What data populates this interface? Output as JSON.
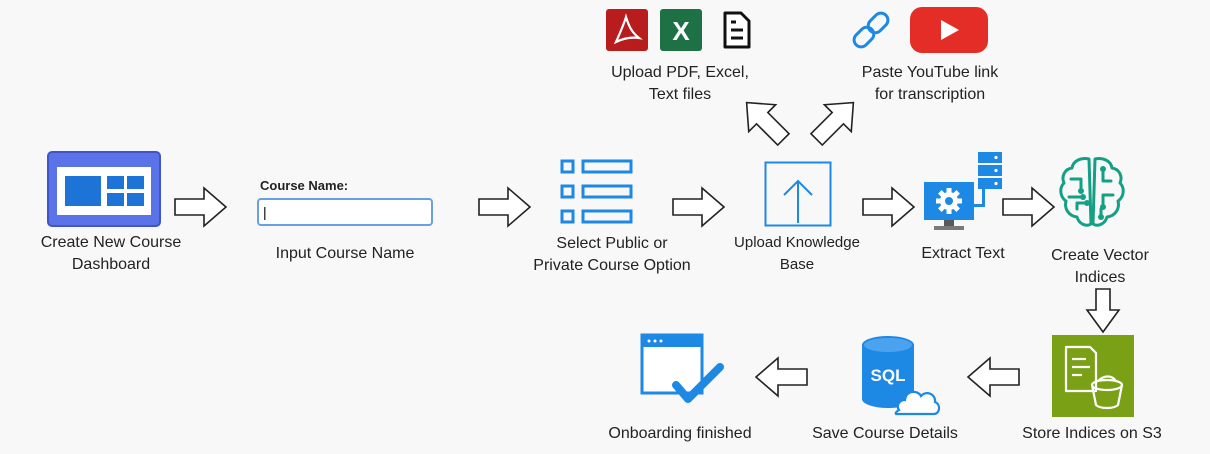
{
  "nodes": {
    "dashboard": {
      "label_line1": "Create New Course",
      "label_line2": "Dashboard",
      "icon": "dashboard-icon"
    },
    "course_name": {
      "field_label": "Course Name:",
      "input_value": "|",
      "label": "Input Course Name"
    },
    "visibility": {
      "label_line1": "Select Public or",
      "label_line2": "Private Course Option",
      "icon": "list-icon"
    },
    "upload": {
      "label_line1": "Upload Knowledge",
      "label_line2": "Base",
      "icon": "upload-icon"
    },
    "extract": {
      "label": "Extract Text",
      "icon": "server-gear-icon"
    },
    "vector": {
      "label_line1": "Create Vector",
      "label_line2": "Indices",
      "icon": "ai-brain-icon"
    },
    "s3": {
      "label": "Store Indices on S3",
      "icon": "s3-bucket-icon"
    },
    "sql": {
      "label": "Save Course Details",
      "icon": "sql-database-icon"
    },
    "done": {
      "label": "Onboarding finished",
      "icon": "window-check-icon"
    },
    "files": {
      "label_line1": "Upload PDF, Excel,",
      "label_line2": "Text files",
      "icons": [
        "pdf-icon",
        "excel-icon",
        "text-file-icon"
      ]
    },
    "youtube": {
      "label_line1": "Paste YouTube link",
      "label_line2": "for transcription",
      "icons": [
        "link-icon",
        "youtube-icon"
      ]
    }
  },
  "colors": {
    "accent_blue": "#1e88e5",
    "teal": "#14a085",
    "s3_green": "#7aa116",
    "pdf_red": "#c5221f",
    "excel_green": "#1e7145",
    "youtube_red": "#e52d27"
  }
}
